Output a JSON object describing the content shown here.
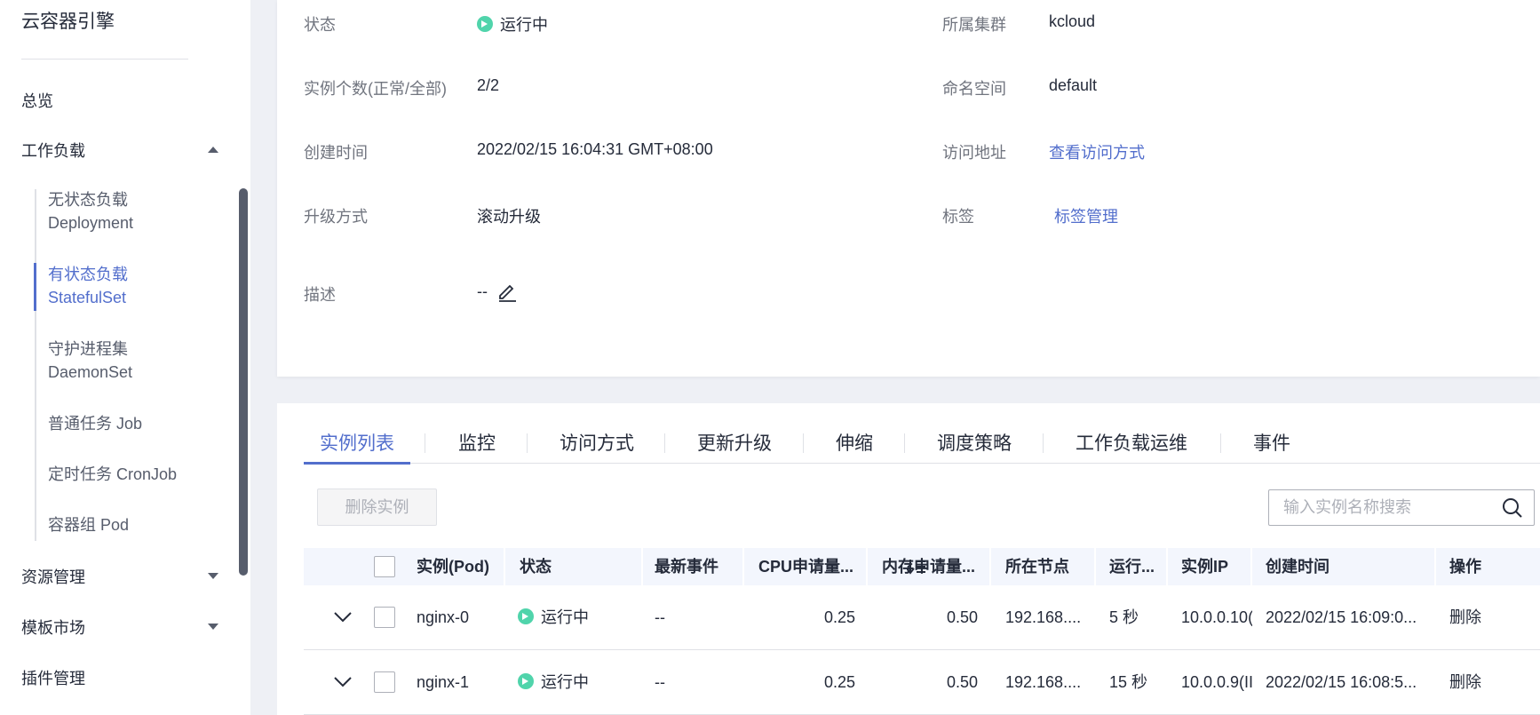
{
  "sidebar": {
    "title": "云容器引擎",
    "overview": "总览",
    "workload": "工作负载",
    "subitems": [
      {
        "line1": "无状态负载",
        "line2": "Deployment"
      },
      {
        "line1": "有状态负载",
        "line2": "StatefulSet"
      },
      {
        "line1": "守护进程集",
        "line2": "DaemonSet"
      },
      {
        "line1": "普通任务 Job"
      },
      {
        "line1": "定时任务 CronJob"
      },
      {
        "line1": "容器组 Pod"
      }
    ],
    "resource": "资源管理",
    "template": "模板市场",
    "plugin": "插件管理"
  },
  "details": {
    "status_label": "状态",
    "status_value": "运行中",
    "cluster_label": "所属集群",
    "cluster_value": "kcloud",
    "instances_label": "实例个数(正常/全部)",
    "instances_value": "2/2",
    "namespace_label": "命名空间",
    "namespace_value": "default",
    "created_label": "创建时间",
    "created_value": "2022/02/15 16:04:31 GMT+08:00",
    "access_label": "访问地址",
    "access_value": "查看访问方式",
    "upgrade_label": "升级方式",
    "upgrade_value": "滚动升级",
    "tags_label": "标签",
    "tags_value": "标签管理",
    "desc_label": "描述",
    "desc_value": "--"
  },
  "tabs": [
    "实例列表",
    "监控",
    "访问方式",
    "更新升级",
    "伸缩",
    "调度策略",
    "工作负载运维",
    "事件"
  ],
  "toolbar": {
    "delete_label": "删除实例",
    "search_placeholder": "输入实例名称搜索"
  },
  "table": {
    "headers": {
      "pod": "实例(Pod)",
      "status": "状态",
      "event": "最新事件",
      "cpu": "CPU申请量...",
      "mem": "内存申请量...",
      "node": "所在节点",
      "runtime": "运行...",
      "ip": "实例IP",
      "created": "创建时间",
      "action": "操作"
    },
    "rows": [
      {
        "pod": "nginx-0",
        "status": "运行中",
        "event": "--",
        "cpu": "0.25",
        "mem": "0.50",
        "node": "192.168....",
        "runtime": "5 秒",
        "ip": "10.0.0.10(",
        "created": "2022/02/15 16:09:0...",
        "action": "删除"
      },
      {
        "pod": "nginx-1",
        "status": "运行中",
        "event": "--",
        "cpu": "0.25",
        "mem": "0.50",
        "node": "192.168....",
        "runtime": "15 秒",
        "ip": "10.0.0.9(II",
        "created": "2022/02/15 16:08:5...",
        "action": "删除"
      }
    ]
  },
  "colors": {
    "accent": "#526ecc",
    "running": "#50d4ab"
  }
}
